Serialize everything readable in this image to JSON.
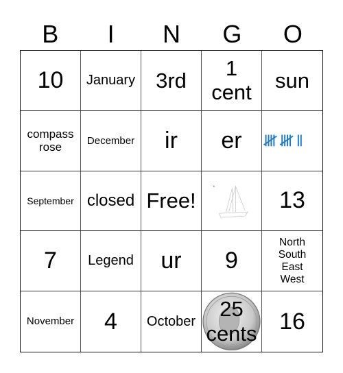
{
  "card": {
    "header": [
      "B",
      "I",
      "N",
      "G",
      "O"
    ],
    "cells": [
      {
        "text": "10",
        "size": "s-xl"
      },
      {
        "text": "January",
        "size": "s-m"
      },
      {
        "text": "3rd",
        "size": "s-l"
      },
      {
        "text": "1\ncent",
        "size": "s-l"
      },
      {
        "text": "sun",
        "size": "s-l"
      },
      {
        "text": "compass\nrose",
        "size": "s-s"
      },
      {
        "text": "December",
        "size": "s-xs"
      },
      {
        "text": "ir",
        "size": "s-xl"
      },
      {
        "text": "er",
        "size": "s-xl"
      },
      {
        "text": "",
        "size": "s-m",
        "image": "tally-marks-icon",
        "tally_count": 12
      },
      {
        "text": "September",
        "size": "s-xxs"
      },
      {
        "text": "closed",
        "size": "s-ml"
      },
      {
        "text": "Free!",
        "size": "s-l"
      },
      {
        "text": "",
        "size": "s-m",
        "image": "sailboat-icon"
      },
      {
        "text": "13",
        "size": "s-xl"
      },
      {
        "text": "7",
        "size": "s-xl"
      },
      {
        "text": "Legend",
        "size": "s-m"
      },
      {
        "text": "ur",
        "size": "s-xl"
      },
      {
        "text": "9",
        "size": "s-xl"
      },
      {
        "text": "North\nSouth\nEast\nWest",
        "size": "s-nsew"
      },
      {
        "text": "November",
        "size": "s-xs"
      },
      {
        "text": "4",
        "size": "s-xl"
      },
      {
        "text": "October",
        "size": "s-m"
      },
      {
        "text": "25\ncents",
        "size": "s-l",
        "image": "quarter-coin-icon"
      },
      {
        "text": "16",
        "size": "s-xl"
      }
    ]
  },
  "colors": {
    "tally": "#1f7ccc",
    "grid_line": "#333333"
  }
}
